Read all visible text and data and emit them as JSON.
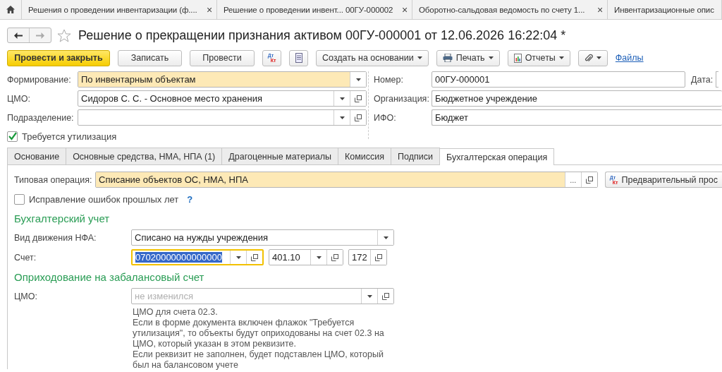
{
  "window_tabs": [
    {
      "label": "Решения о проведении инвентаризации (ф....",
      "close": "×",
      "selected": false
    },
    {
      "label": "Решение о проведении инвент... 00ГУ-000002",
      "close": "×",
      "selected": false
    },
    {
      "label": "Оборотно-сальдовая ведомость по счету 1...",
      "close": "×",
      "selected": false
    },
    {
      "label": "Инвентаризационные опис",
      "selected": false
    }
  ],
  "title": "Решение о прекращении признания активом 00ГУ-000001 от 12.06.2026 16:22:04 *",
  "favorite": false,
  "toolbar": [
    {
      "kind": "primary",
      "label": "Провести и закрыть"
    },
    {
      "kind": "button",
      "label": "Записать"
    },
    {
      "kind": "button",
      "label": "Провести"
    },
    {
      "kind": "dtkt",
      "top": "Дт",
      "bottom": "Кт"
    },
    {
      "kind": "list"
    },
    {
      "kind": "menu",
      "label": "Создать на основании"
    },
    {
      "kind": "print",
      "label": "Печать"
    },
    {
      "kind": "reports",
      "label": "Отчеты"
    },
    {
      "kind": "attach"
    },
    {
      "kind": "link",
      "label": "Файлы"
    }
  ],
  "header_left": [
    {
      "label": "Формирование:",
      "value": "По инвентарным объектам",
      "highlighted": true,
      "buttons": [
        {
          "kind": "dropdown"
        }
      ]
    },
    {
      "label": "ЦМО:",
      "value": "Сидоров С. С. - Основное место хранения",
      "highlighted": false,
      "buttons": [
        {
          "kind": "dropdown"
        },
        {
          "kind": "open"
        }
      ]
    },
    {
      "label": "Подразделение:",
      "highlighted": false,
      "buttons": [
        {
          "kind": "dropdown"
        },
        {
          "kind": "open"
        }
      ]
    }
  ],
  "disposal_checkbox": {
    "label": "Требуется утилизация",
    "checked": true
  },
  "header_right": [
    {
      "label": "Номер:",
      "value": "00ГУ-000001",
      "extra_label": "Дата:"
    },
    {
      "label": "Организация:",
      "value": "Бюджетное учреждение"
    },
    {
      "label": "ИФО:",
      "value": "Бюджет"
    }
  ],
  "form_tabs": [
    {
      "label": "Основание",
      "selected": false
    },
    {
      "label": "Основные средства, НМА, НПА (1)",
      "selected": false
    },
    {
      "label": "Драгоценные материалы",
      "selected": false
    },
    {
      "label": "Комиссия",
      "selected": false
    },
    {
      "label": "Подписи",
      "selected": false
    },
    {
      "label": "Бухгалтерская операция",
      "selected": true
    }
  ],
  "operation": {
    "label": "Типовая операция:",
    "value": "Списание объектов ОС, НМА, НПА",
    "highlighted": true,
    "buttons": [
      {
        "kind": "choose",
        "label": "..."
      },
      {
        "kind": "open"
      }
    ],
    "preview_button": {
      "top": "Дт",
      "bottom": "Кт",
      "label": "Предварительный прос"
    }
  },
  "corrections_checkbox": {
    "label": "Исправление ошибок прошлых лет",
    "checked": false,
    "help": "?"
  },
  "accounting": {
    "title": "Бухгалтерский учет",
    "movement": {
      "label": "Вид движения НФА:",
      "value": "Списано на нужды учреждения",
      "buttons": [
        {
          "kind": "dropdown"
        }
      ]
    },
    "account": {
      "label": "Счет:",
      "fields": [
        {
          "value": "07020000000000000",
          "focused": true,
          "text_selected": true,
          "buttons": [
            {
              "kind": "dropdown"
            },
            {
              "kind": "open"
            }
          ]
        },
        {
          "value": "401.10",
          "focused": false,
          "text_selected": false,
          "buttons": [
            {
              "kind": "dropdown"
            },
            {
              "kind": "open"
            }
          ]
        },
        {
          "value": "172",
          "focused": false,
          "text_selected": false,
          "buttons": [
            {
              "kind": "open"
            }
          ]
        }
      ]
    }
  },
  "off_balance": {
    "title": "Оприходование на забалансовый счет",
    "field": {
      "label": "ЦМО:",
      "placeholder": "не изменился",
      "buttons": [
        {
          "kind": "dropdown"
        },
        {
          "kind": "open"
        }
      ]
    },
    "hint": [
      "ЦМО для счета 02.3.",
      "Если в форме документа включен флажок \"Требуется утилизация\", то объекты будут оприходованы на счет 02.3 на ЦМО, который указан в этом реквизите.",
      "Если реквизит не заполнен, будет подставлен ЦМО, который был на балансовом учете"
    ]
  }
}
